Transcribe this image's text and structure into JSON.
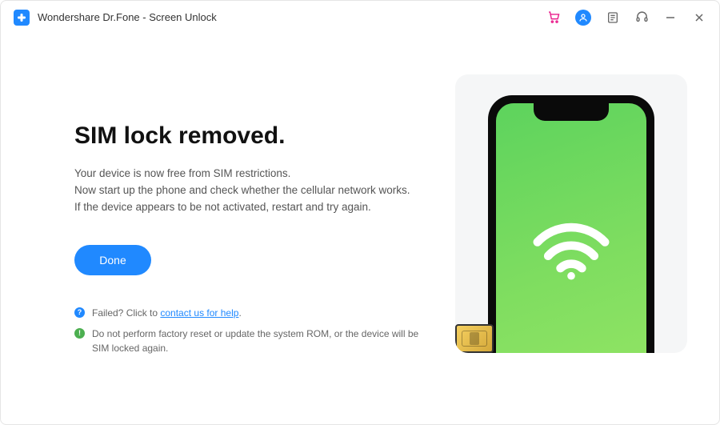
{
  "app": {
    "title": "Wondershare Dr.Fone - Screen Unlock"
  },
  "content": {
    "heading": "SIM lock removed.",
    "body_line1": "Your device is now free from SIM restrictions.",
    "body_line2": "Now start up the phone and check whether the cellular network works.",
    "body_line3": "If the device appears to be not activated, restart and try again.",
    "done_label": "Done"
  },
  "notes": {
    "help_prefix": "Failed? Click to ",
    "help_link": "contact us for help",
    "help_suffix": ".",
    "warning": "Do not perform factory reset or update the system ROM, or the device will be SIM locked again."
  }
}
